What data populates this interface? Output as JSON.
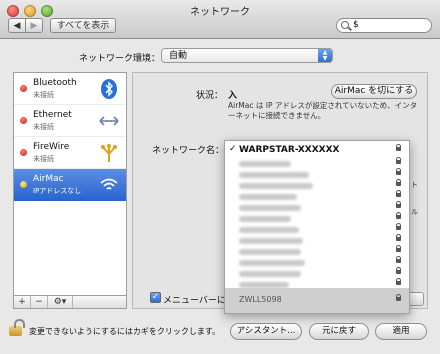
{
  "window": {
    "title": "ネットワーク",
    "show_all": "すべてを表示",
    "back": "◀",
    "forward": "▶",
    "search_value": "$"
  },
  "location": {
    "label": "ネットワーク環境：",
    "value": "自動"
  },
  "services": [
    {
      "name": "Bluetooth",
      "status": "未接続",
      "icon": "bluetooth-icon",
      "selected": false
    },
    {
      "name": "Ethernet",
      "status": "未接続",
      "icon": "ethernet-icon",
      "selected": false
    },
    {
      "name": "FireWire",
      "status": "未接続",
      "icon": "firewire-icon",
      "selected": false
    },
    {
      "name": "AirMac",
      "status": "IPアドレスなし",
      "icon": "wifi-icon",
      "selected": true
    }
  ],
  "sidebar_buttons": {
    "add": "+",
    "remove": "−",
    "action": "⚙▾"
  },
  "detail": {
    "status_label": "状況：",
    "status_value": "入",
    "turn_off_button": "AirMac を切にする",
    "description": "AirMac は IP アドレスが設定されていないため、インターネットに接続できません。",
    "network_name_label": "ネットワーク名：",
    "peek_1": "ト",
    "peek_2": "ル",
    "menubar_checkbox_label": "メニューバーに"
  },
  "network_menu": {
    "connected": "WARPSTAR-XXXXXX",
    "checkmark": "✓",
    "hidden_networks": 12,
    "last_item": "ZWLL5098"
  },
  "footer": {
    "lock_text": "変更できないようにするにはカギをクリックします。",
    "assistant_button": "アシスタント...",
    "revert_button": "元に戻す",
    "apply_button": "適用"
  },
  "colors": {
    "selection": "#2a64cf",
    "status_off": "#c4211a",
    "status_warn": "#d4a00f"
  }
}
